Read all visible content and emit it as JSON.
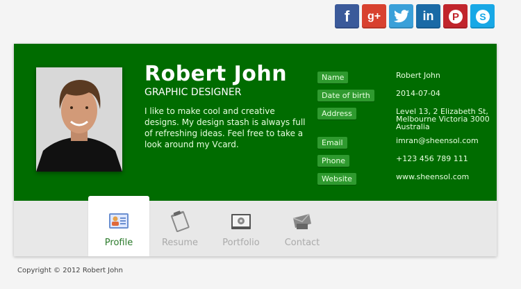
{
  "colors": {
    "card_green": "#006c00",
    "label_green": "#2f9a2f",
    "facebook": "#3b5a9a",
    "google_plus": "#d8412f",
    "twitter": "#3aa0d9",
    "linkedin": "#1a6aa6",
    "pinterest": "#c1252c",
    "skype": "#18a8e6"
  },
  "social": [
    {
      "name": "facebook-icon",
      "glyph": "f"
    },
    {
      "name": "google-plus-icon",
      "glyph": "g+"
    },
    {
      "name": "twitter-icon",
      "glyph": "twitter"
    },
    {
      "name": "linkedin-icon",
      "glyph": "in"
    },
    {
      "name": "pinterest-icon",
      "glyph": "P"
    },
    {
      "name": "skype-icon",
      "glyph": "S"
    }
  ],
  "profile": {
    "name": "Robert John",
    "role": "GRAPHIC DESIGNER",
    "bio": "I like to make cool and creative designs. My design stash is always full of refreshing ideas. Feel free to take a look around my Vcard."
  },
  "info": [
    {
      "label": "Name",
      "value": "Robert John"
    },
    {
      "label": "Date of birth",
      "value": "2014-07-04"
    },
    {
      "label": "Address",
      "value": "Level 13, 2 Elizabeth St, Melbourne Victoria 3000 Australia"
    },
    {
      "label": "Email",
      "value": "imran@sheensol.com"
    },
    {
      "label": "Phone",
      "value": "+123 456 789 111"
    },
    {
      "label": "Website",
      "value": "www.sheensol.com"
    }
  ],
  "tabs": [
    {
      "label": "Profile",
      "icon": "profile-card-icon",
      "active": true
    },
    {
      "label": "Resume",
      "icon": "clipboard-icon",
      "active": false
    },
    {
      "label": "Portfolio",
      "icon": "photo-album-icon",
      "active": false
    },
    {
      "label": "Contact",
      "icon": "mail-icon",
      "active": false
    }
  ],
  "footer": {
    "copyright": "Copyright © 2012 Robert John"
  }
}
